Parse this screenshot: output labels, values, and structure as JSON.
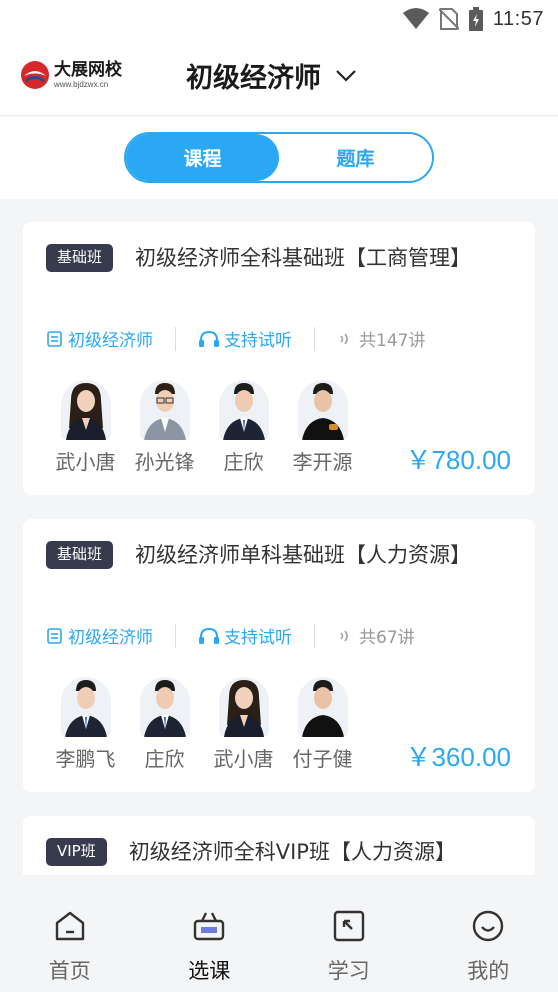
{
  "status_bar": {
    "time": "11:57"
  },
  "header": {
    "logo_name": "大展网校",
    "logo_url": "www.bjdzwx.cn",
    "title": "初级经济师"
  },
  "tabs": {
    "course": "课程",
    "question_bank": "题库"
  },
  "courses": [
    {
      "badge": "基础班",
      "title": "初级经济师全科基础班【工商管理】",
      "category": "初级经济师",
      "trial": "支持试听",
      "lessons": "共147讲",
      "teachers": [
        "武小唐",
        "孙光锋",
        "庄欣",
        "李开源"
      ],
      "price": "￥780.00"
    },
    {
      "badge": "基础班",
      "title": "初级经济师单科基础班【人力资源】",
      "category": "初级经济师",
      "trial": "支持试听",
      "lessons": "共67讲",
      "teachers": [
        "李鹏飞",
        "庄欣",
        "武小唐",
        "付子健"
      ],
      "price": "￥360.00"
    },
    {
      "badge": "VIP班",
      "title": "初级经济师全科VIP班【人力资源】"
    }
  ],
  "nav": [
    {
      "label": "首页",
      "icon": "home-icon"
    },
    {
      "label": "选课",
      "icon": "basket-icon"
    },
    {
      "label": "学习",
      "icon": "study-icon"
    },
    {
      "label": "我的",
      "icon": "profile-icon"
    }
  ],
  "colors": {
    "accent": "#2ba8f4",
    "badge_bg": "#373b4d",
    "page_bg": "#f4f5f7"
  }
}
